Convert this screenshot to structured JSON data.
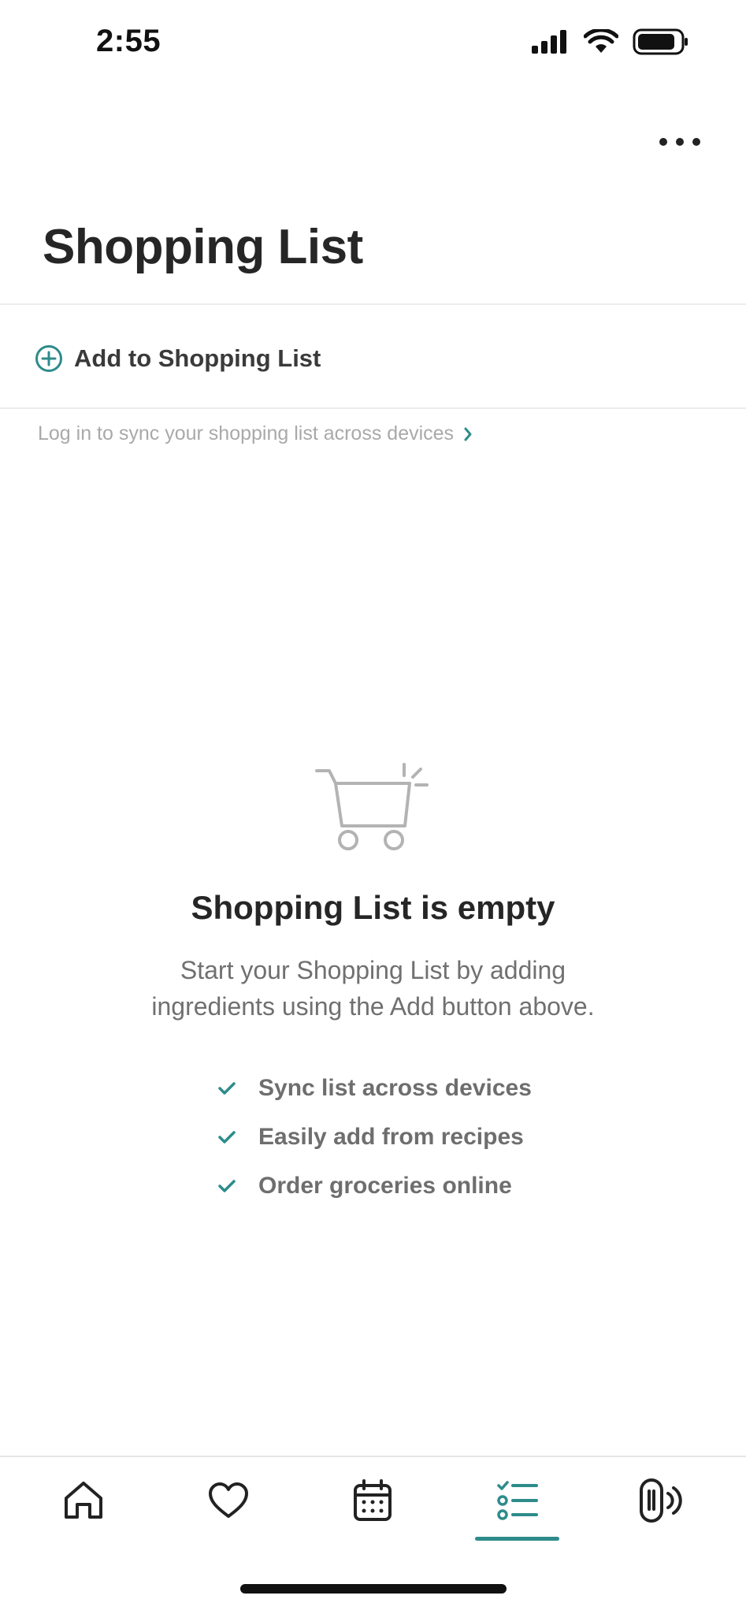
{
  "status_bar": {
    "time": "2:55"
  },
  "header": {
    "title": "Shopping List",
    "more_icon": "more-horizontal-icon"
  },
  "add_item": {
    "icon": "plus-circle-icon",
    "label": "Add to Shopping List"
  },
  "login_prompt": {
    "text": "Log in to sync your shopping list across devices",
    "icon": "chevron-right-icon"
  },
  "empty_state": {
    "icon": "shopping-cart-icon",
    "title": "Shopping List is empty",
    "description_line1": "Start your Shopping List by adding",
    "description_line2": "ingredients using the Add button above.",
    "features": [
      {
        "icon": "check-icon",
        "label": "Sync list across devices"
      },
      {
        "icon": "check-icon",
        "label": "Easily add from recipes"
      },
      {
        "icon": "check-icon",
        "label": "Order groceries online"
      }
    ]
  },
  "tab_bar": {
    "tabs": [
      {
        "icon": "home-icon",
        "active": false
      },
      {
        "icon": "heart-icon",
        "active": false
      },
      {
        "icon": "calendar-icon",
        "active": false
      },
      {
        "icon": "checklist-icon",
        "active": true
      },
      {
        "icon": "device-signal-icon",
        "active": false
      }
    ]
  },
  "colors": {
    "accent": "#2e8b8b",
    "text_primary": "#262626",
    "text_secondary": "#707070",
    "text_muted": "#a9a9a9"
  }
}
